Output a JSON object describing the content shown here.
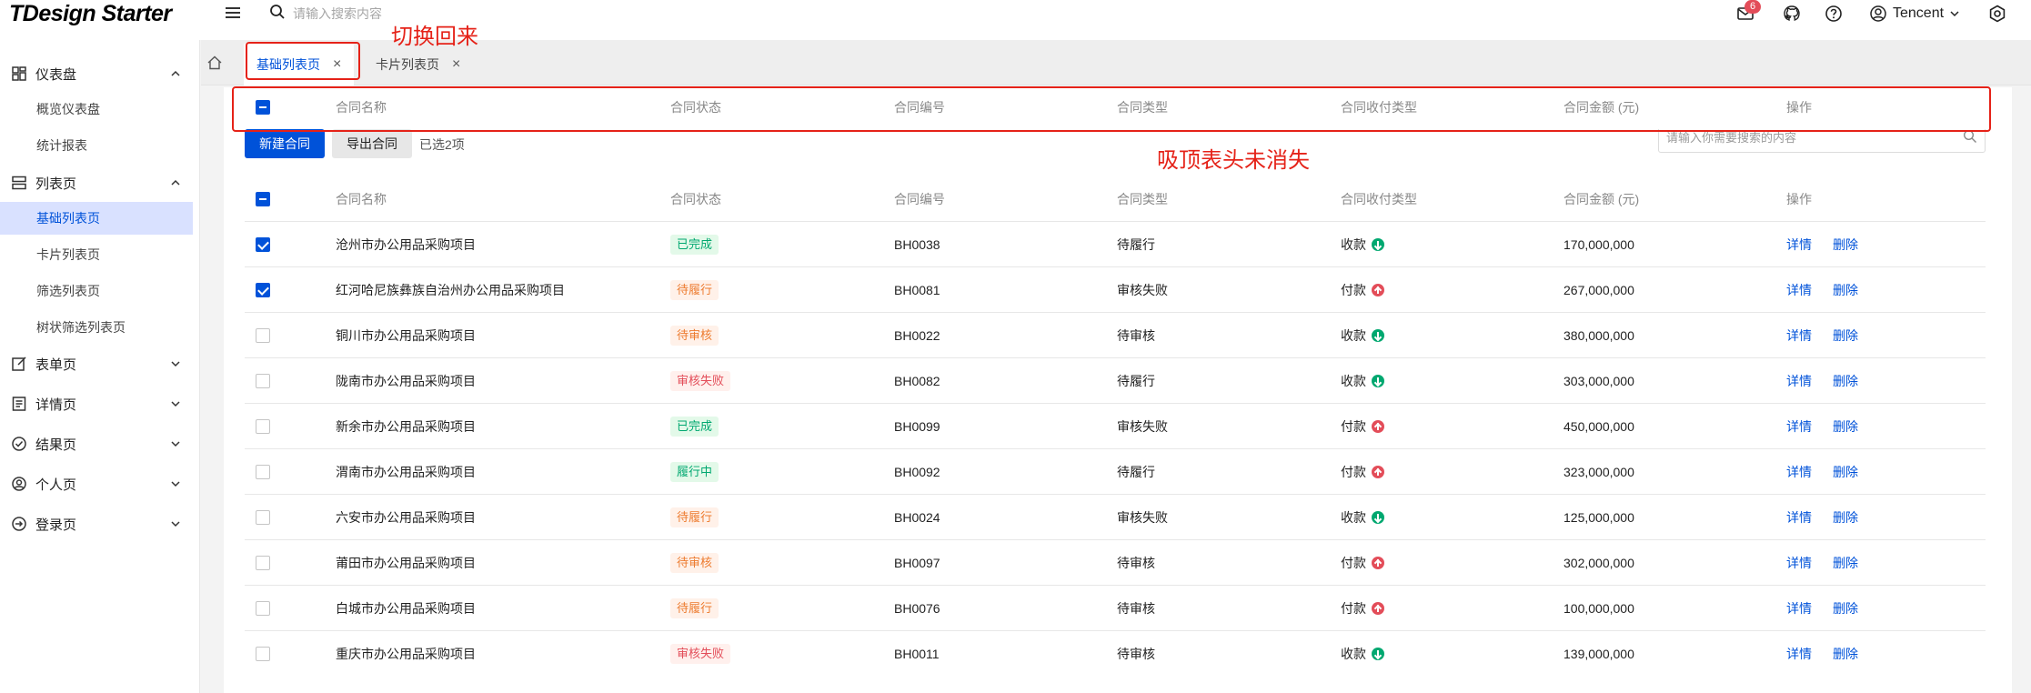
{
  "header": {
    "logo_prefix": "T",
    "logo_text": "TDesign Starter",
    "search_placeholder": "请输入搜索内容",
    "mail_badge": "6",
    "user_name": "Tencent"
  },
  "sidebar": {
    "groups": [
      {
        "label": "仪表盘",
        "icon": "dashboard-icon",
        "expanded": true
      },
      {
        "label": "列表页",
        "icon": "list-icon",
        "expanded": true
      },
      {
        "label": "表单页",
        "icon": "form-icon",
        "expanded": false
      },
      {
        "label": "详情页",
        "icon": "detail-icon",
        "expanded": false
      },
      {
        "label": "结果页",
        "icon": "check-circle-icon",
        "expanded": false
      },
      {
        "label": "个人页",
        "icon": "user-circle-icon",
        "expanded": false
      },
      {
        "label": "登录页",
        "icon": "login-icon",
        "expanded": false
      }
    ],
    "dashboard_items": [
      "概览仪表盘",
      "统计报表"
    ],
    "list_items": [
      "基础列表页",
      "卡片列表页",
      "筛选列表页",
      "树状筛选列表页"
    ],
    "active_item": "基础列表页"
  },
  "tabs": [
    {
      "label": "基础列表页",
      "active": true
    },
    {
      "label": "卡片列表页",
      "active": false
    }
  ],
  "toolbar": {
    "new_button": "新建合同",
    "export_button": "导出合同",
    "selected_text": "已选2项",
    "search_placeholder": "请输入你需要搜索的内容"
  },
  "table": {
    "columns": [
      "合同名称",
      "合同状态",
      "合同编号",
      "合同类型",
      "合同收付类型",
      "合同金额 (元)",
      "操作"
    ],
    "rows": [
      {
        "name": "沧州市办公用品采购项目",
        "status": "已完成",
        "status_kind": "success",
        "code": "BH0038",
        "type": "待履行",
        "pay": "收款",
        "pay_dir": "down",
        "amount": "170,000,000",
        "checked": true
      },
      {
        "name": "红河哈尼族彝族自治州办公用品采购项目",
        "status": "待履行",
        "status_kind": "warning",
        "code": "BH0081",
        "type": "审核失败",
        "pay": "付款",
        "pay_dir": "up",
        "amount": "267,000,000",
        "checked": true
      },
      {
        "name": "铜川市办公用品采购项目",
        "status": "待审核",
        "status_kind": "warning",
        "code": "BH0022",
        "type": "待审核",
        "pay": "收款",
        "pay_dir": "down",
        "amount": "380,000,000",
        "checked": false
      },
      {
        "name": "陇南市办公用品采购项目",
        "status": "审核失败",
        "status_kind": "error",
        "code": "BH0082",
        "type": "待履行",
        "pay": "收款",
        "pay_dir": "down",
        "amount": "303,000,000",
        "checked": false
      },
      {
        "name": "新余市办公用品采购项目",
        "status": "已完成",
        "status_kind": "success",
        "code": "BH0099",
        "type": "审核失败",
        "pay": "付款",
        "pay_dir": "up",
        "amount": "450,000,000",
        "checked": false
      },
      {
        "name": "渭南市办公用品采购项目",
        "status": "履行中",
        "status_kind": "success",
        "code": "BH0092",
        "type": "待履行",
        "pay": "付款",
        "pay_dir": "up",
        "amount": "323,000,000",
        "checked": false
      },
      {
        "name": "六安市办公用品采购项目",
        "status": "待履行",
        "status_kind": "warning",
        "code": "BH0024",
        "type": "审核失败",
        "pay": "收款",
        "pay_dir": "down",
        "amount": "125,000,000",
        "checked": false
      },
      {
        "name": "莆田市办公用品采购项目",
        "status": "待审核",
        "status_kind": "warning",
        "code": "BH0097",
        "type": "待审核",
        "pay": "付款",
        "pay_dir": "up",
        "amount": "302,000,000",
        "checked": false
      },
      {
        "name": "白城市办公用品采购项目",
        "status": "待履行",
        "status_kind": "warning",
        "code": "BH0076",
        "type": "待审核",
        "pay": "付款",
        "pay_dir": "up",
        "amount": "100,000,000",
        "checked": false
      },
      {
        "name": "重庆市办公用品采购项目",
        "status": "审核失败",
        "status_kind": "error",
        "code": "BH0011",
        "type": "待审核",
        "pay": "收款",
        "pay_dir": "down",
        "amount": "139,000,000",
        "checked": false
      }
    ],
    "action_detail": "详情",
    "action_delete": "删除"
  },
  "annotations": {
    "switch_back": "切换回来",
    "sticky_header_note": "吸顶表头未消失"
  },
  "colors": {
    "brand": "#0052d9",
    "success_bg": "#e3f9e9",
    "success_fg": "#00a870",
    "warning_bg": "#fff1e9",
    "warning_fg": "#ed7b2f",
    "error_bg": "#fff0ed",
    "error_fg": "#e34d59",
    "annotation": "#e52218"
  }
}
